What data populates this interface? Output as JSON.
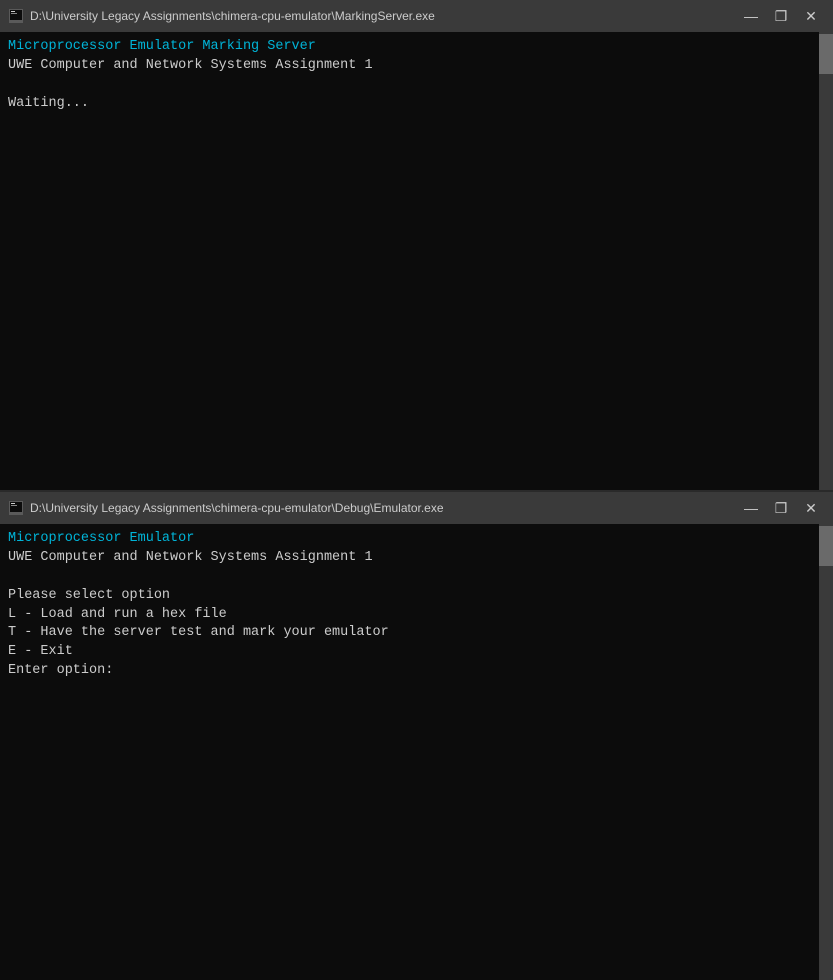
{
  "topWindow": {
    "titleBar": {
      "icon": "console-icon",
      "path": "D:\\University Legacy Assignments\\chimera-cpu-emulator\\MarkingServer.exe",
      "minimizeLabel": "—",
      "restoreLabel": "❐",
      "closeLabel": "✕"
    },
    "content": {
      "line1": "Microprocessor Emulator Marking Server",
      "line2": "UWE Computer and Network Systems Assignment 1",
      "line3": "",
      "line4": "Waiting..."
    }
  },
  "bottomWindow": {
    "titleBar": {
      "icon": "console-icon",
      "path": "D:\\University Legacy Assignments\\chimera-cpu-emulator\\Debug\\Emulator.exe",
      "minimizeLabel": "—",
      "restoreLabel": "❐",
      "closeLabel": "✕"
    },
    "content": {
      "line1": "Microprocessor Emulator",
      "line2": "UWE Computer and Network Systems Assignment 1",
      "line3": "",
      "line4": "Please select option",
      "line5": "L - Load and run a hex file",
      "line6": "T - Have the server test and mark your emulator",
      "line7": "E - Exit",
      "line8": "Enter option:"
    }
  }
}
